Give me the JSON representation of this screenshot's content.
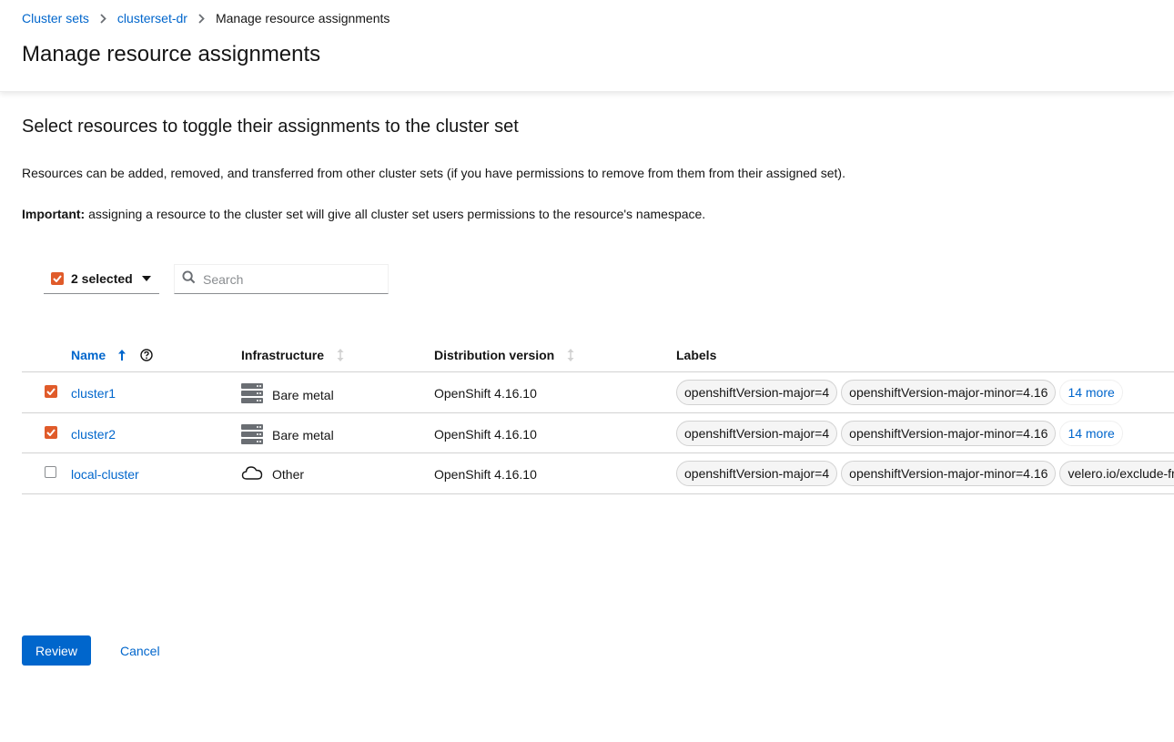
{
  "breadcrumb": {
    "items": [
      "Cluster sets",
      "clusterset-dr"
    ],
    "current": "Manage resource assignments"
  },
  "page_title": "Manage resource assignments",
  "section_title": "Select resources to toggle their assignments to the cluster set",
  "description": "Resources can be added, removed, and transferred from other cluster sets (if you have permissions to remove from them from their assigned set).",
  "important": {
    "label": "Important:",
    "text": " assigning a resource to the cluster set will give all cluster set users permissions to the resource's namespace."
  },
  "toolbar": {
    "bulk_select_label": "2 selected",
    "search_placeholder": "Search"
  },
  "table": {
    "headers": {
      "name": "Name",
      "infrastructure": "Infrastructure",
      "distribution": "Distribution version",
      "labels": "Labels"
    },
    "rows": [
      {
        "checked": true,
        "name": "cluster1",
        "infra_icon": "server-icon",
        "infrastructure": "Bare metal",
        "distribution": "OpenShift 4.16.10",
        "labels": [
          "openshiftVersion-major=4",
          "openshiftVersion-major-minor=4.16"
        ],
        "more": "14 more"
      },
      {
        "checked": true,
        "name": "cluster2",
        "infra_icon": "server-icon",
        "infrastructure": "Bare metal",
        "distribution": "OpenShift 4.16.10",
        "labels": [
          "openshiftVersion-major=4",
          "openshiftVersion-major-minor=4.16"
        ],
        "more": "14 more"
      },
      {
        "checked": false,
        "name": "local-cluster",
        "infra_icon": "cloud-icon",
        "infrastructure": "Other",
        "distribution": "OpenShift 4.16.10",
        "labels": [
          "openshiftVersion-major=4",
          "openshiftVersion-major-minor=4.16",
          "velero.io/exclude-from-backup=true"
        ],
        "more": ""
      }
    ]
  },
  "actions": {
    "review_label": "Review",
    "cancel_label": "Cancel"
  },
  "colors": {
    "link": "#0066cc",
    "checkbox": "#e05b2a",
    "primary": "#0066cc"
  }
}
